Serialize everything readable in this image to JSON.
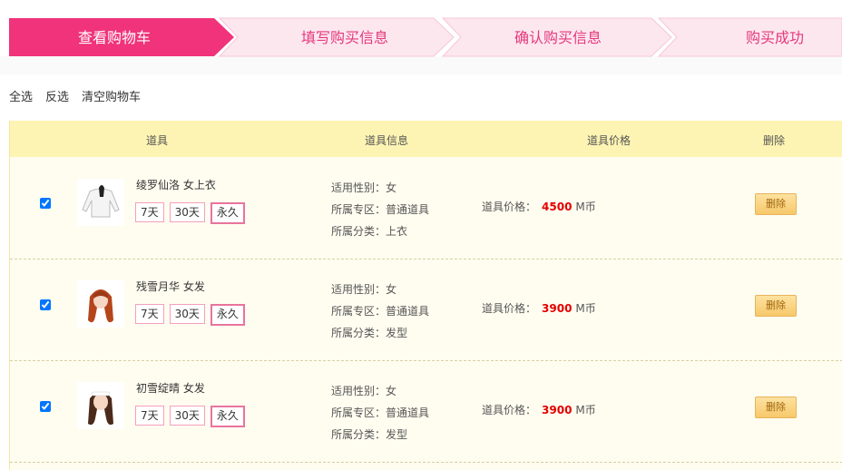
{
  "steps": [
    {
      "label": "查看购物车"
    },
    {
      "label": "填写购买信息"
    },
    {
      "label": "确认购买信息"
    },
    {
      "label": "购买成功"
    }
  ],
  "actions": {
    "select_all": "全选",
    "invert": "反选",
    "clear": "清空购物车"
  },
  "headers": {
    "item": "道具",
    "info": "道具信息",
    "price": "道具价格",
    "delete": "删除"
  },
  "rows": [
    {
      "name": "绫罗仙洛 女上衣",
      "opts": [
        "7天",
        "30天",
        "永久"
      ],
      "gender": "适用性别：女",
      "zone": "所属专区：普通道具",
      "category": "所属分类：上衣",
      "price_label": "道具价格：",
      "price": "4500",
      "unit": "M币",
      "delete": "删除"
    },
    {
      "name": "残雪月华 女发",
      "opts": [
        "7天",
        "30天",
        "永久"
      ],
      "gender": "适用性别：女",
      "zone": "所属专区：普通道具",
      "category": "所属分类：发型",
      "price_label": "道具价格：",
      "price": "3900",
      "unit": "M币",
      "delete": "删除"
    },
    {
      "name": "初雪绽晴 女发",
      "opts": [
        "7天",
        "30天",
        "永久"
      ],
      "gender": "适用性别：女",
      "zone": "所属专区：普通道具",
      "category": "所属分类：发型",
      "price_label": "道具价格：",
      "price": "3900",
      "unit": "M币",
      "delete": "删除"
    }
  ],
  "colors": {
    "active_step": "#f0337a",
    "inactive_step": "#fde7ef",
    "header_bg": "#fdf4b3",
    "price": "#e30000"
  }
}
